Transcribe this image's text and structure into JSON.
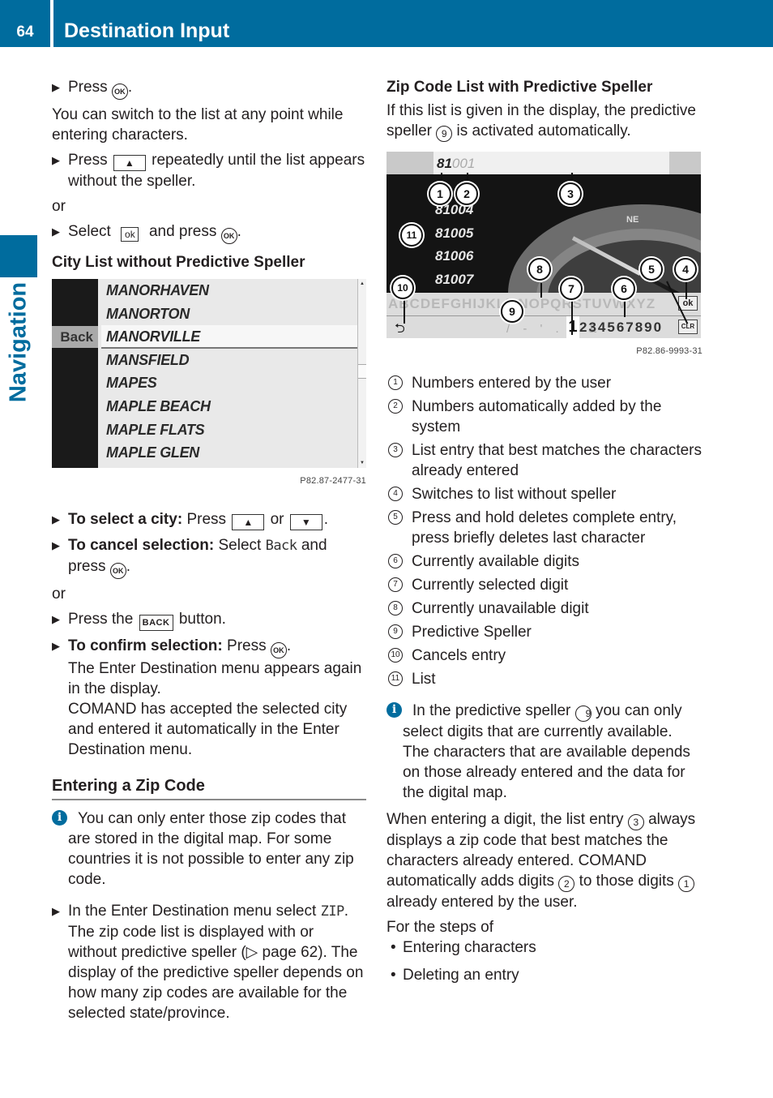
{
  "header": {
    "page_number": "64",
    "title": "Destination Input"
  },
  "side_tab": {
    "label": "Navigation"
  },
  "colors": {
    "brand": "#006c9e"
  },
  "left": {
    "step_press_ok": {
      "text": "Press",
      "key": "OK",
      "end": "."
    },
    "switch_note": "You can switch to the list at any point while entering characters.",
    "step_press_up": {
      "text": "Press",
      "key": "▲",
      "rest": "repeatedly until the list appears without the speller."
    },
    "or1": "or",
    "step_select_ok": {
      "text": "Select",
      "key": "ok",
      "rest": "and press",
      "key2": "OK",
      "end": "."
    },
    "city_list_heading": "City List without Predictive Speller",
    "city_screen": {
      "back_label": "Back",
      "cities": [
        "MANORHAVEN",
        "MANORTON",
        "MANORVILLE",
        "MANSFIELD",
        "MAPES",
        "MAPLE BEACH",
        "MAPLE FLATS",
        "MAPLE GLEN"
      ],
      "selected_index": 2,
      "figure_code": "P82.87-2477-31"
    },
    "select_city": {
      "label": "To select a city:",
      "text": "Press",
      "key_up": "▲",
      "or": "or",
      "key_down": "▼",
      "end": "."
    },
    "cancel_selection": {
      "label": "To cancel selection:",
      "text": "Select",
      "mono": "Back",
      "rest": "and press",
      "key": "OK",
      "end": "."
    },
    "or2": "or",
    "press_back": {
      "text": "Press the",
      "key": "BACK",
      "rest": "button."
    },
    "confirm_selection": {
      "label": "To confirm selection:",
      "text": "Press",
      "key": "OK",
      "end": ".",
      "line2": "The Enter Destination menu appears again in the display.",
      "line3": "COMAND has accepted the selected city and entered it automatically in the Enter Destination menu."
    },
    "zip_heading": "Entering a Zip Code",
    "zip_info": "You can only enter those zip codes that are stored in the digital map. For some countries it is not possible to enter any zip code.",
    "zip_step": {
      "text": "In the Enter Destination menu select",
      "mono": "ZIP",
      "end": ".",
      "rest": "The zip code list is displayed with or without predictive speller (▷ page 62). The display of the predictive speller depends on how many zip codes are available for the selected state/province."
    }
  },
  "right": {
    "heading": "Zip Code List with Predictive Speller",
    "intro_a": "If this list is given in the display, the predictive speller",
    "intro_ref": "9",
    "intro_b": "is activated automatically.",
    "zip_screen": {
      "input_user": "81",
      "input_auto": "001",
      "zip_codes": [
        "81004",
        "81005",
        "81006",
        "81007"
      ],
      "compass_label": "NE",
      "letters": "ABCDEFGHIJKLMNOPQRSTUVWXYZ",
      "back_arrow": "⮌",
      "punctuation": "/ - ' . , &",
      "selected_digit": "1",
      "digits": "234567890",
      "ok_key": "ok",
      "clr_key": "CLR",
      "callouts": [
        "1",
        "2",
        "3",
        "4",
        "5",
        "6",
        "7",
        "8",
        "9",
        "10",
        "11"
      ],
      "figure_code": "P82.86-9993-31"
    },
    "legend": [
      {
        "num": "1",
        "text": "Numbers entered by the user"
      },
      {
        "num": "2",
        "text": "Numbers automatically added by the system"
      },
      {
        "num": "3",
        "text": "List entry that best matches the characters already entered"
      },
      {
        "num": "4",
        "text": "Switches to list without speller"
      },
      {
        "num": "5",
        "text": "Press and hold deletes complete entry, press briefly deletes last character"
      },
      {
        "num": "6",
        "text": "Currently available digits"
      },
      {
        "num": "7",
        "text": "Currently selected digit"
      },
      {
        "num": "8",
        "text": "Currently unavailable digit"
      },
      {
        "num": "9",
        "text": "Predictive Speller"
      },
      {
        "num": "10",
        "text": "Cancels entry"
      },
      {
        "num": "11",
        "text": "List"
      }
    ],
    "info": {
      "a": "In the predictive speller",
      "ref": "9",
      "b": "you can only select digits that are currently available. The characters that are available depends on those already entered and the data for the digital map."
    },
    "para": {
      "a": "When entering a digit, the list entry",
      "ref3": "3",
      "b": "always displays a zip code that best matches the characters already entered. COMAND automatically adds digits",
      "ref2": "2",
      "c": "to those digits",
      "ref1": "1",
      "d": "already entered by the user."
    },
    "steps_intro": "For the steps of",
    "bullets": [
      "Entering characters",
      "Deleting an entry"
    ]
  }
}
